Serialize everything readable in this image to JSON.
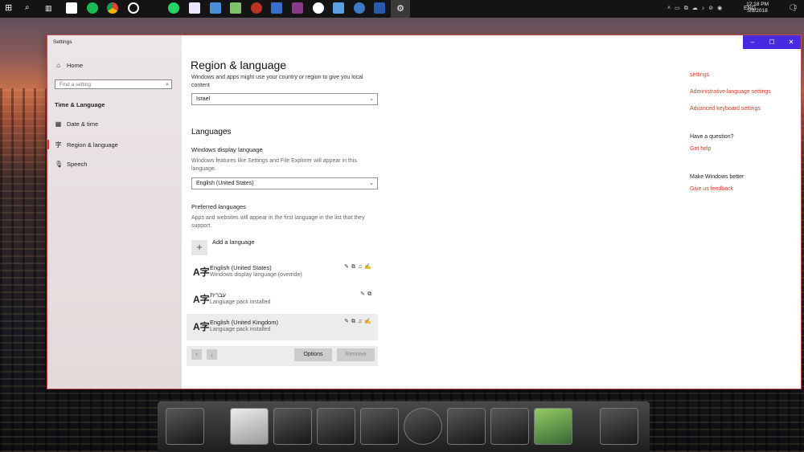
{
  "taskbar": {
    "tray": [
      "ENG"
    ],
    "clock_time": "12:18 PM",
    "clock_date": "5/8/2018",
    "notification_count": "1",
    "icons": [
      "windows-icon",
      "search-icon",
      "task-view-icon",
      "calendar-icon",
      "spotify-icon",
      "chrome-icon",
      "target-icon",
      "whatsapp-icon",
      "paint-icon",
      "folder-icon",
      "notepad-icon",
      "vpn-icon",
      "network-icon",
      "winrar-icon",
      "clock-icon",
      "monitor-icon",
      "globe-icon",
      "app-icon",
      "settings-icon"
    ]
  },
  "window": {
    "app_title": "Settings",
    "minimize": "–",
    "maximize": "☐",
    "close": "✕"
  },
  "sidebar": {
    "home": "Home",
    "search_placeholder": "Find a setting",
    "section": "Time & Language",
    "items": [
      "Date & time",
      "Region & language",
      "Speech"
    ]
  },
  "main": {
    "title": "Region & language",
    "country_desc": "Windows and apps might use your country or region to give you local content",
    "country_value": "Israel",
    "languages_heading": "Languages",
    "display_lang_label": "Windows display language",
    "display_lang_desc": "Windows features like Settings and File Explorer will appear in this language.",
    "display_lang_value": "English (United States)",
    "preferred_label": "Preferred languages",
    "preferred_desc": "Apps and websites will appear in the first language in the list that they support.",
    "add_language": "Add a language",
    "languages": [
      {
        "name": "English (United States)",
        "status": "Windows display language (override)"
      },
      {
        "name": "עברית",
        "status": "Language pack installed"
      },
      {
        "name": "English (United Kingdom)",
        "status": "Language pack installed"
      }
    ],
    "options_button": "Options",
    "remove_button": "Remove"
  },
  "right_panel": {
    "cut_link": "settings",
    "admin_link": "Administrative language settings",
    "keyboard_link": "Advanced keyboard settings",
    "question_heading": "Have a question?",
    "help_link": "Get help",
    "better_heading": "Make Windows better",
    "feedback_link": "Give us feedback"
  },
  "colors": {
    "accent": "#d03c2a",
    "titlebar": "#4a2ae0"
  },
  "dock": {
    "items": [
      "monitor-icon",
      "document-icon",
      "player-icon",
      "tablet-icon",
      "folder-icon",
      "speaker-icon",
      "skull-icon",
      "disc-icon",
      "photo-icon",
      "recycle-bin-icon"
    ]
  }
}
